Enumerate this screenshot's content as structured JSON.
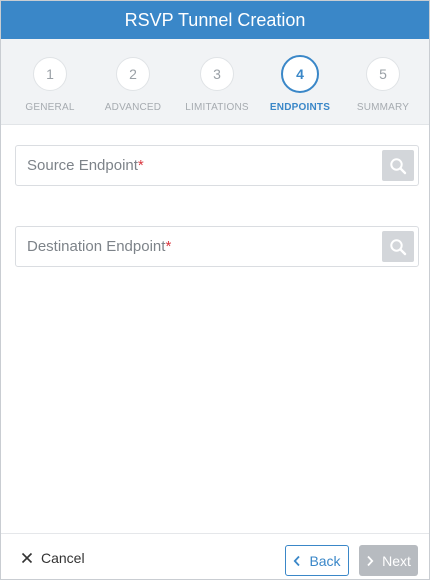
{
  "title": "RSVP Tunnel Creation",
  "steps": [
    {
      "number": "1",
      "label": "GENERAL"
    },
    {
      "number": "2",
      "label": "ADVANCED"
    },
    {
      "number": "3",
      "label": "LIMITATIONS"
    },
    {
      "number": "4",
      "label": "ENDPOINTS",
      "active": true
    },
    {
      "number": "5",
      "label": "SUMMARY"
    }
  ],
  "fields": {
    "source": {
      "placeholder": "Source Endpoint",
      "required_mark": "*"
    },
    "destination": {
      "placeholder": "Destination Endpoint",
      "required_mark": "*"
    }
  },
  "footer": {
    "cancel_label": "Cancel",
    "back_label": "Back",
    "next_label": "Next"
  },
  "colors": {
    "accent": "#3a87c8",
    "required": "#d9363e",
    "disabled": "#b7bbc0"
  }
}
